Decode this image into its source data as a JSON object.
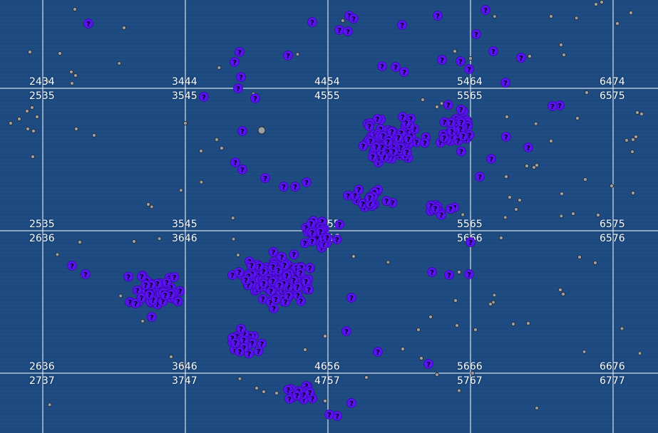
{
  "map": {
    "background_color": "#1d4a80",
    "grid_color": "#ffffff",
    "marker_color": "#5a12f0",
    "marker_symbol": "?",
    "object_color": "#9aa0a6",
    "grid_labels": [
      [
        "2434",
        "3444",
        "4454",
        "5464",
        "6474"
      ],
      [
        "2535",
        "3545",
        "4555",
        "5565",
        "6575"
      ],
      [
        "2535",
        "3545",
        "4555",
        "5565",
        "6575"
      ],
      [
        "2636",
        "3646",
        "4656",
        "5666",
        "6576"
      ],
      [
        "2636",
        "3646",
        "4656",
        "5666",
        "6676"
      ],
      [
        "2737",
        "3747",
        "4757",
        "5767",
        "6777"
      ]
    ]
  }
}
